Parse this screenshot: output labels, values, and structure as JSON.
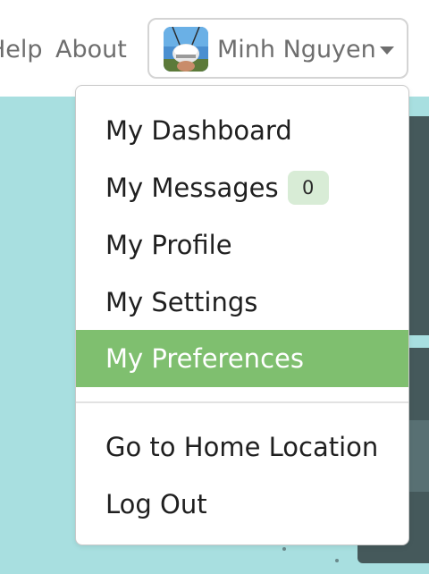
{
  "nav": {
    "help_label": "Help",
    "about_label": "About"
  },
  "user": {
    "name": "Minh Nguyen",
    "avatar_icon": "user-avatar-photo"
  },
  "menu": {
    "items": [
      {
        "label": "My Dashboard"
      },
      {
        "label": "My Messages",
        "badge": "0"
      },
      {
        "label": "My Profile"
      },
      {
        "label": "My Settings"
      },
      {
        "label": "My Preferences",
        "active": true
      },
      {
        "label": "Go to Home Location"
      },
      {
        "label": "Log Out"
      }
    ]
  },
  "colors": {
    "active_bg": "#7fbf6f",
    "badge_bg": "#d8ecd6",
    "page_bg": "#a8dfe0"
  }
}
